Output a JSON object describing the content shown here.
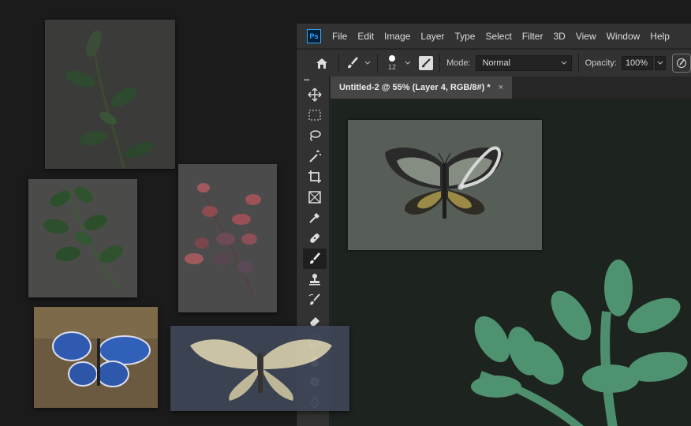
{
  "photoshop": {
    "logo": "Ps",
    "menu": [
      "File",
      "Edit",
      "Image",
      "Layer",
      "Type",
      "Select",
      "Filter",
      "3D",
      "View",
      "Window",
      "Help"
    ],
    "options": {
      "brush_size": "12",
      "mode_label": "Mode:",
      "mode_value": "Normal",
      "opacity_label": "Opacity:",
      "opacity_value": "100%"
    },
    "document_tab": {
      "title": "Untitled-2 @ 55% (Layer 4, RGB/8#) *",
      "close": "×"
    },
    "tools": [
      "move-tool",
      "marquee-tool",
      "lasso-tool",
      "magic-wand-tool",
      "crop-tool",
      "frame-tool",
      "eyedropper-tool",
      "healing-tool",
      "brush-tool",
      "stamp-tool",
      "history-brush-tool",
      "eraser-tool",
      "gradient-tool",
      "blur-tool",
      "dodge-tool",
      "pen-tool"
    ],
    "active_tool": "brush-tool",
    "accent_color": "#31a8ff"
  },
  "desktop_photos": [
    "fern-photo",
    "green-leaves-photo",
    "pink-leaves-photo",
    "blue-butterfly-photo",
    "moth-photo"
  ]
}
